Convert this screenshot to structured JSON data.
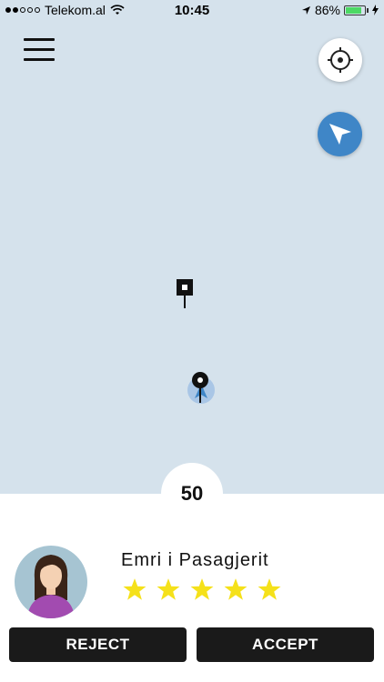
{
  "status_bar": {
    "carrier": "Telekom.al",
    "signal_dots_filled": 2,
    "signal_dots_total": 5,
    "time": "10:45",
    "battery_percent": "86%",
    "battery_level": 0.86,
    "battery_color": "#4cd964"
  },
  "map": {
    "background_color": "#d5e2ec",
    "menu_icon": "hamburger-menu-icon",
    "locate_icon": "crosshair-icon",
    "navigate_icon": "navigation-arrow-icon",
    "accent_color": "#3f86c7"
  },
  "ride": {
    "price": "50"
  },
  "passenger": {
    "name": "Emri i Pasagjerit",
    "rating": 5,
    "star_color": "#f5e11a"
  },
  "actions": {
    "reject_label": "REJECT",
    "accept_label": "ACCEPT"
  }
}
